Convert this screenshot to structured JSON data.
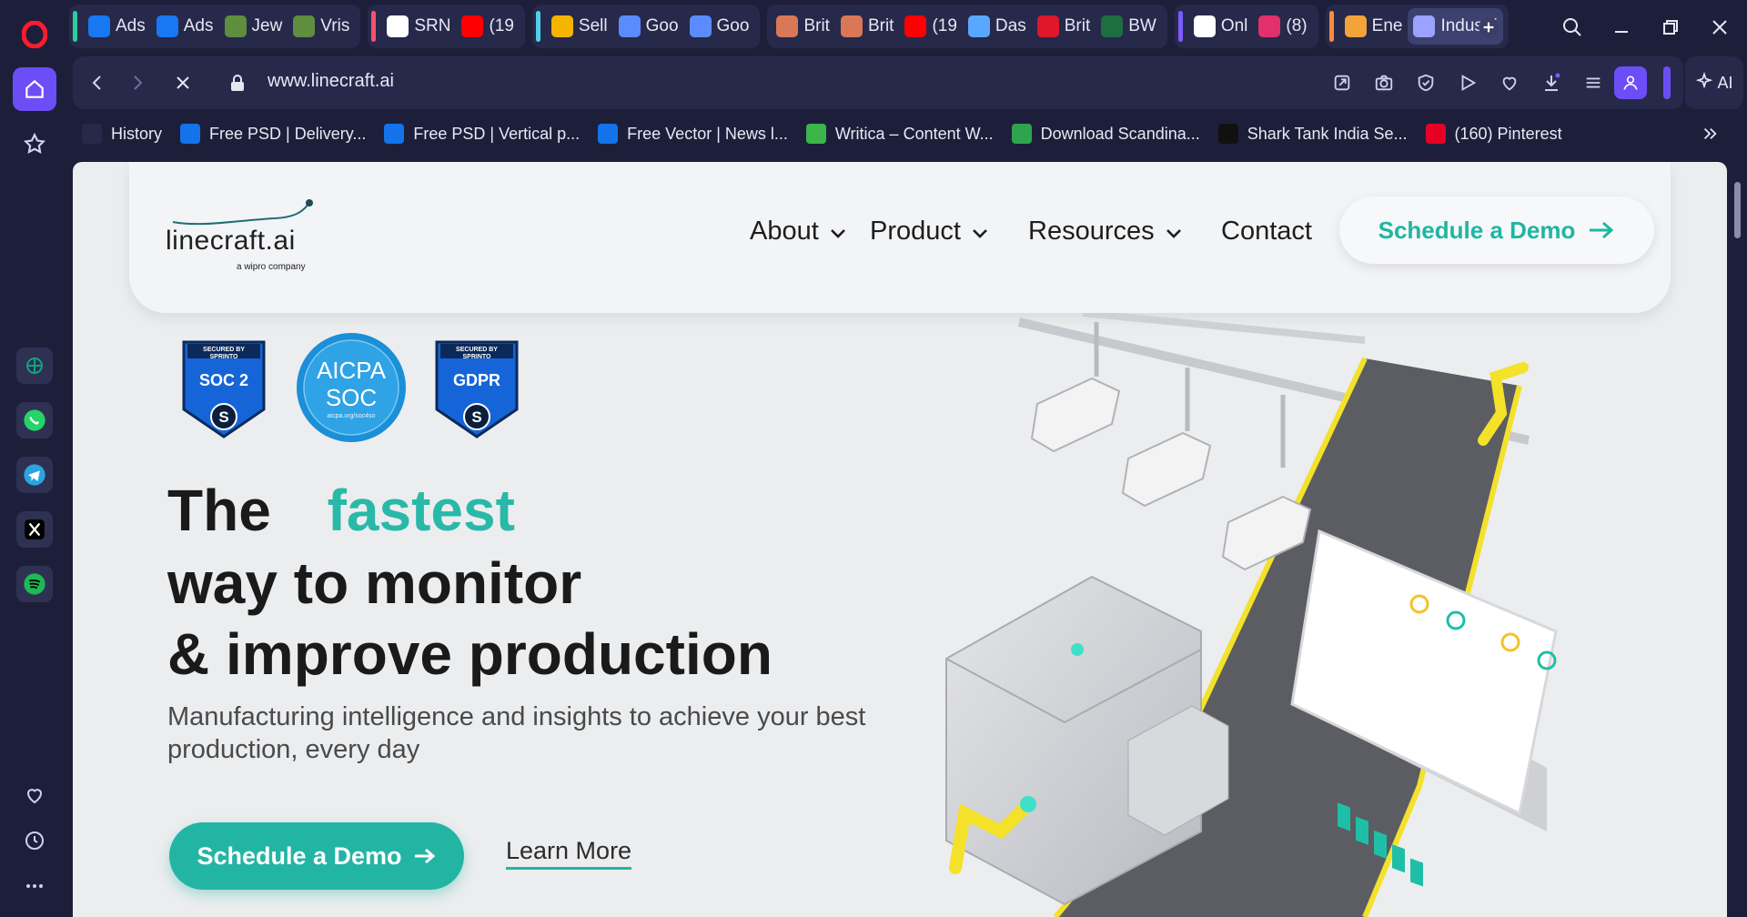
{
  "browser": {
    "tab_groups": [
      {
        "color": "#2ecc9a",
        "tabs": [
          {
            "label": "Ads",
            "icon": "meta-icon",
            "color": "#1877f2"
          },
          {
            "label": "Ads",
            "icon": "meta-icon",
            "color": "#1877f2"
          },
          {
            "label": "Jew",
            "icon": "shopify-icon",
            "color": "#5e8e3e"
          },
          {
            "label": "Vris",
            "icon": "shopify-icon",
            "color": "#5e8e3e"
          }
        ]
      },
      {
        "color": "#ff4f6d",
        "tabs": [
          {
            "label": "SRN",
            "icon": "threads-icon",
            "color": "#ffffff"
          },
          {
            "label": "(19",
            "icon": "youtube-icon",
            "color": "#ff0000"
          }
        ]
      },
      {
        "color": "#4fd1e8",
        "tabs": [
          {
            "label": "Sell",
            "icon": "sheets-icon",
            "color": "#f4b400"
          },
          {
            "label": "Goo",
            "icon": "gemini-icon",
            "color": "#5b8cff"
          },
          {
            "label": "Goo",
            "icon": "gemini-icon",
            "color": "#5b8cff"
          }
        ]
      },
      {
        "color": "",
        "tabs": [
          {
            "label": "Brit",
            "icon": "claude-icon",
            "color": "#d97757"
          },
          {
            "label": "Brit",
            "icon": "claude-icon",
            "color": "#d97757"
          },
          {
            "label": "(19",
            "icon": "youtube-icon",
            "color": "#ff0000"
          },
          {
            "label": "Das",
            "icon": "dashboard-icon",
            "color": "#5aa7ff"
          },
          {
            "label": "Brit",
            "icon": "lips-icon",
            "color": "#e0162b"
          },
          {
            "label": "BW",
            "icon": "excel-icon",
            "color": "#1d6f42"
          }
        ]
      },
      {
        "color": "#7b5cff",
        "tabs": [
          {
            "label": "Onl",
            "icon": "openai-icon",
            "color": "#ffffff"
          },
          {
            "label": "(8)",
            "icon": "instagram-icon",
            "color": "#e1306c"
          }
        ]
      },
      {
        "color": "#ff8a3d",
        "tabs": [
          {
            "label": "Ene",
            "icon": "drink-icon",
            "color": "#f2a33a"
          },
          {
            "label": "Industri",
            "icon": "loading-icon",
            "color": "#9aa3ff",
            "active": true
          }
        ]
      }
    ],
    "url": "www.linecraft.ai",
    "ai_label": "AI",
    "bookmarks": [
      {
        "label": "History",
        "icon": "clock-icon",
        "color": "#26294a"
      },
      {
        "label": "Free PSD | Delivery...",
        "icon": "freepik-icon",
        "color": "#1273eb"
      },
      {
        "label": "Free PSD | Vertical p...",
        "icon": "freepik-icon",
        "color": "#1273eb"
      },
      {
        "label": "Free Vector | News l...",
        "icon": "freepik-icon",
        "color": "#1273eb"
      },
      {
        "label": "Writica – Content W...",
        "icon": "writica-icon",
        "color": "#3bb54a"
      },
      {
        "label": "Download Scandina...",
        "icon": "ae-icon",
        "color": "#2ea44f"
      },
      {
        "label": "Shark Tank India Se...",
        "icon": "sharktank-icon",
        "color": "#111111"
      },
      {
        "label": "(160) Pinterest",
        "icon": "pinterest-icon",
        "color": "#e60023"
      }
    ]
  },
  "site": {
    "logo_text": "linecraft.ai",
    "logo_sub": "a wipro company",
    "nav": [
      {
        "label": "About",
        "has_dropdown": true
      },
      {
        "label": "Product",
        "has_dropdown": true
      },
      {
        "label": "Resources",
        "has_dropdown": true
      },
      {
        "label": "Contact",
        "has_dropdown": false
      }
    ],
    "header_cta": "Schedule a Demo",
    "badges": {
      "soc2_top": "SECURED BY SPRINTO",
      "soc2_main": "SOC 2",
      "aicpa_line1": "AICPA",
      "aicpa_line2": "SOC",
      "aicpa_small": "aicpa.org/soc4so",
      "gdpr_top": "SECURED BY SPRINTO",
      "gdpr_main": "GDPR"
    },
    "hero": {
      "line1_a": "The",
      "line1_highlight": "fastest",
      "line2": "way to monitor",
      "line3": "& improve production",
      "subtitle": "Manufacturing intelligence and insights to achieve your best production, every day",
      "primary_cta": "Schedule a Demo",
      "secondary_cta": "Learn More"
    },
    "accent_color": "#23b5a3"
  }
}
